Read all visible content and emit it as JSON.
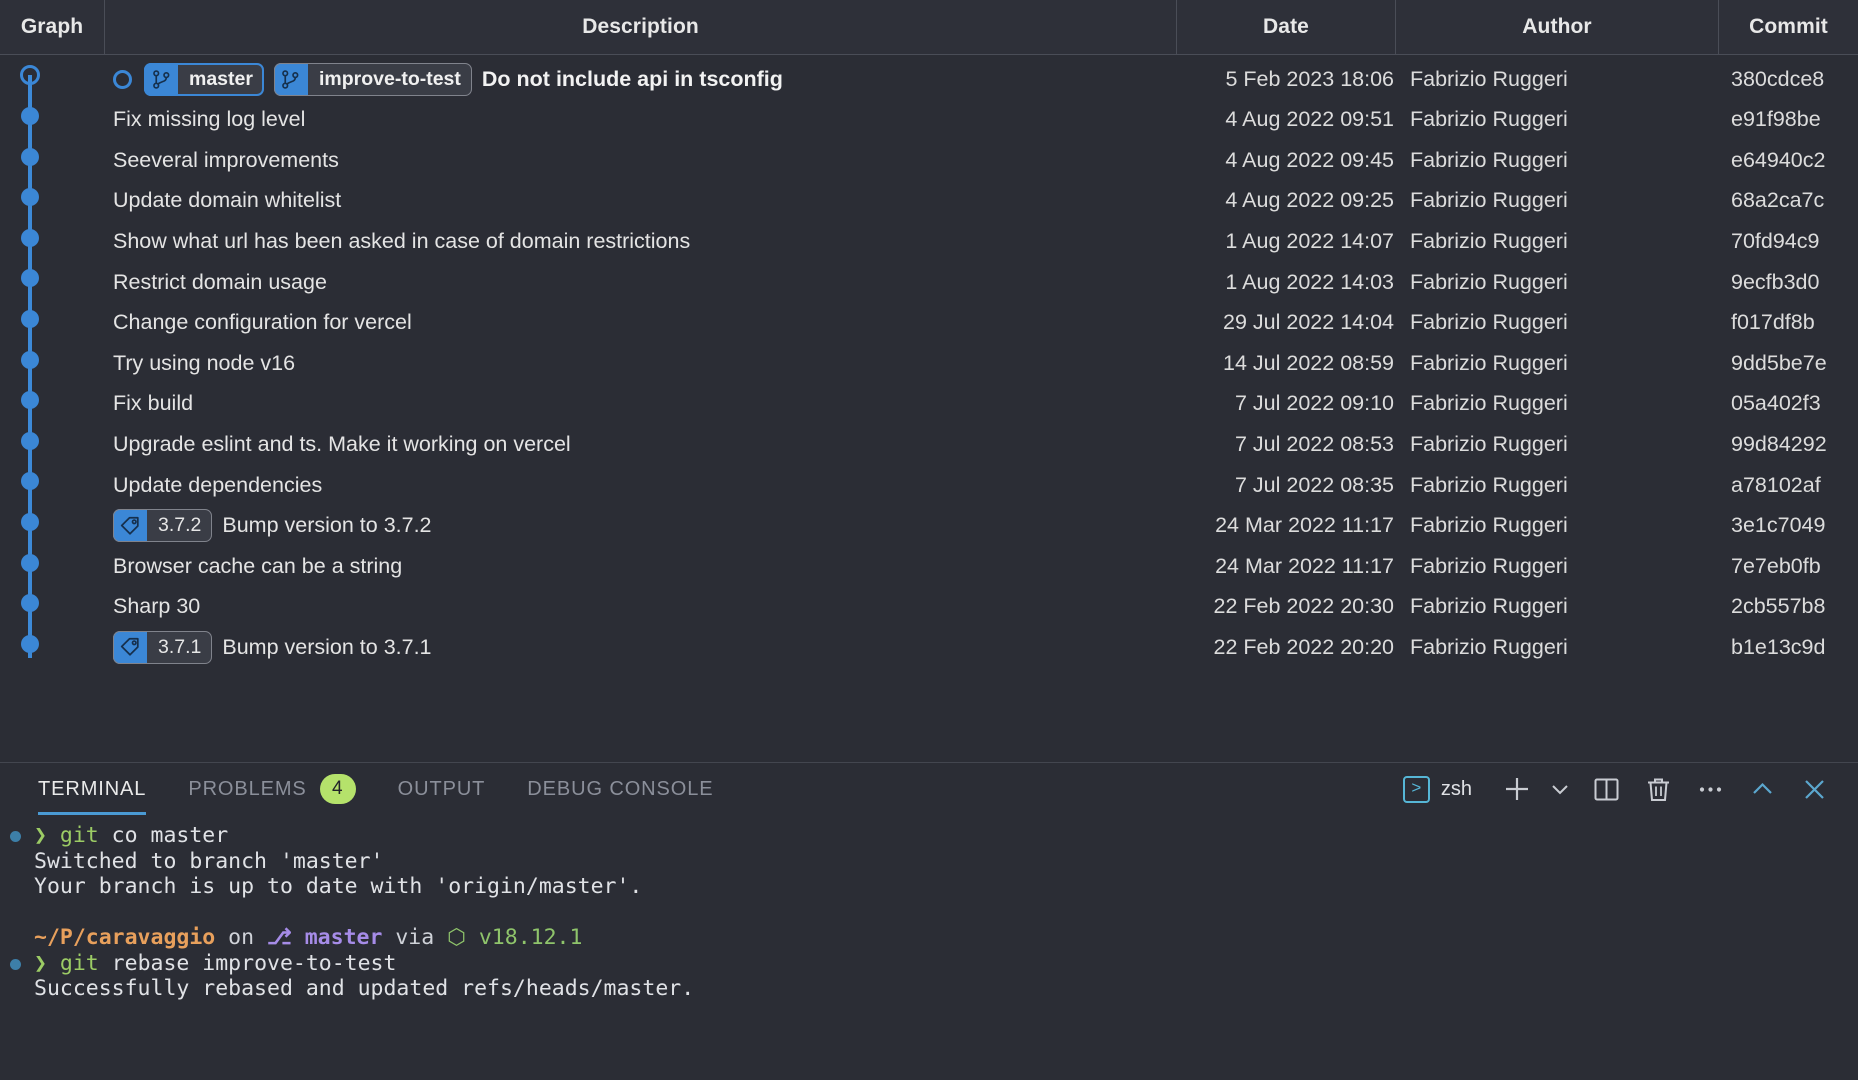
{
  "git_graph": {
    "columns": [
      {
        "id": "graph",
        "label": "Graph"
      },
      {
        "id": "description",
        "label": "Description"
      },
      {
        "id": "date",
        "label": "Date"
      },
      {
        "id": "author",
        "label": "Author"
      },
      {
        "id": "commit",
        "label": "Commit"
      }
    ],
    "rows": [
      {
        "head_marker": true,
        "refs": [
          {
            "type": "branch",
            "name": "master",
            "current": true
          },
          {
            "type": "branch",
            "name": "improve-to-test",
            "current": false
          }
        ],
        "description": "Do not include api in tsconfig",
        "date": "5 Feb 2023 18:06",
        "author": "Fabrizio Ruggeri",
        "commit": "380cdce8",
        "dot": "hollow"
      },
      {
        "refs": [],
        "description": "Fix missing log level",
        "date": "4 Aug 2022 09:51",
        "author": "Fabrizio Ruggeri",
        "commit": "e91f98be",
        "dot": "filled"
      },
      {
        "refs": [],
        "description": "Seeveral improvements",
        "date": "4 Aug 2022 09:45",
        "author": "Fabrizio Ruggeri",
        "commit": "e64940c2",
        "dot": "filled"
      },
      {
        "refs": [],
        "description": "Update domain whitelist",
        "date": "4 Aug 2022 09:25",
        "author": "Fabrizio Ruggeri",
        "commit": "68a2ca7c",
        "dot": "filled"
      },
      {
        "refs": [],
        "description": "Show what url has been asked in case of domain restrictions",
        "date": "1 Aug 2022 14:07",
        "author": "Fabrizio Ruggeri",
        "commit": "70fd94c9",
        "dot": "filled"
      },
      {
        "refs": [],
        "description": "Restrict domain usage",
        "date": "1 Aug 2022 14:03",
        "author": "Fabrizio Ruggeri",
        "commit": "9ecfb3d0",
        "dot": "filled"
      },
      {
        "refs": [],
        "description": "Change configuration for vercel",
        "date": "29 Jul 2022 14:04",
        "author": "Fabrizio Ruggeri",
        "commit": "f017df8b",
        "dot": "filled"
      },
      {
        "refs": [],
        "description": "Try using node v16",
        "date": "14 Jul 2022 08:59",
        "author": "Fabrizio Ruggeri",
        "commit": "9dd5be7e",
        "dot": "filled"
      },
      {
        "refs": [],
        "description": "Fix build",
        "date": "7 Jul 2022 09:10",
        "author": "Fabrizio Ruggeri",
        "commit": "05a402f3",
        "dot": "filled"
      },
      {
        "refs": [],
        "description": "Upgrade eslint and ts. Make it working on vercel",
        "date": "7 Jul 2022 08:53",
        "author": "Fabrizio Ruggeri",
        "commit": "99d84292",
        "dot": "filled"
      },
      {
        "refs": [],
        "description": "Update dependencies",
        "date": "7 Jul 2022 08:35",
        "author": "Fabrizio Ruggeri",
        "commit": "a78102af",
        "dot": "filled"
      },
      {
        "refs": [
          {
            "type": "tag",
            "name": "3.7.2"
          }
        ],
        "description": "Bump version to 3.7.2",
        "date": "24 Mar 2022 11:17",
        "author": "Fabrizio Ruggeri",
        "commit": "3e1c7049",
        "dot": "filled"
      },
      {
        "refs": [],
        "description": "Browser cache can be a string",
        "date": "24 Mar 2022 11:17",
        "author": "Fabrizio Ruggeri",
        "commit": "7e7eb0fb",
        "dot": "filled"
      },
      {
        "refs": [],
        "description": "Sharp 30",
        "date": "22 Feb 2022 20:30",
        "author": "Fabrizio Ruggeri",
        "commit": "2cb557b8",
        "dot": "filled"
      },
      {
        "refs": [
          {
            "type": "tag",
            "name": "3.7.1"
          }
        ],
        "description": "Bump version to 3.7.1",
        "date": "22 Feb 2022 20:20",
        "author": "Fabrizio Ruggeri",
        "commit": "b1e13c9d",
        "dot": "filled"
      }
    ]
  },
  "panel": {
    "tabs": [
      {
        "id": "terminal",
        "label": "TERMINAL",
        "active": true
      },
      {
        "id": "problems",
        "label": "PROBLEMS",
        "active": false,
        "badge": "4"
      },
      {
        "id": "output",
        "label": "OUTPUT",
        "active": false
      },
      {
        "id": "debug-console",
        "label": "DEBUG CONSOLE",
        "active": false
      }
    ],
    "shell_label": "zsh",
    "shell_glyph": ">",
    "actions": [
      {
        "id": "new-terminal",
        "label": "+"
      },
      {
        "id": "terminal-profile-dropdown",
        "label": "∨"
      },
      {
        "id": "split-terminal",
        "label": "split"
      },
      {
        "id": "kill-terminal",
        "label": "trash"
      },
      {
        "id": "more-actions",
        "label": "···"
      },
      {
        "id": "maximize-panel",
        "label": "∧"
      },
      {
        "id": "close-panel",
        "label": "×"
      }
    ],
    "terminal_lines": [
      {
        "prompt": true,
        "segments": [
          {
            "t": "❯ ",
            "c": "c-green-b"
          },
          {
            "t": "git",
            "c": "c-green"
          },
          {
            "t": " co master",
            "c": "c-white"
          }
        ]
      },
      {
        "prompt": false,
        "segments": [
          {
            "t": "Switched to branch 'master'",
            "c": "c-white"
          }
        ]
      },
      {
        "prompt": false,
        "segments": [
          {
            "t": "Your branch is up to date with 'origin/master'.",
            "c": "c-white"
          }
        ]
      },
      {
        "prompt": false,
        "segments": [
          {
            "t": "",
            "c": "c-white"
          }
        ]
      },
      {
        "prompt": false,
        "segments": [
          {
            "t": "~/P/caravaggio",
            "c": "c-orange"
          },
          {
            "t": " on ",
            "c": "c-gray"
          },
          {
            "t": "⎇ ",
            "c": "c-purple"
          },
          {
            "t": "master",
            "c": "c-purple"
          },
          {
            "t": " via ",
            "c": "c-gray"
          },
          {
            "t": "⬡ ",
            "c": "c-node"
          },
          {
            "t": "v18.12.1",
            "c": "c-node"
          }
        ]
      },
      {
        "prompt": true,
        "segments": [
          {
            "t": "❯ ",
            "c": "c-green-b"
          },
          {
            "t": "git",
            "c": "c-green"
          },
          {
            "t": " rebase improve-to-test",
            "c": "c-white"
          }
        ]
      },
      {
        "prompt": false,
        "segments": [
          {
            "t": "Successfully rebased and updated refs/heads/master.",
            "c": "c-white"
          }
        ]
      }
    ]
  },
  "colors": {
    "background": "#2b2d35",
    "header_bg": "#2e3039",
    "accent_blue": "#3b87d6",
    "tab_accent": "#4a9ad4",
    "badge_green": "#b5e26b",
    "text": "#e4e4e4",
    "muted_text": "#8b8f9a"
  }
}
